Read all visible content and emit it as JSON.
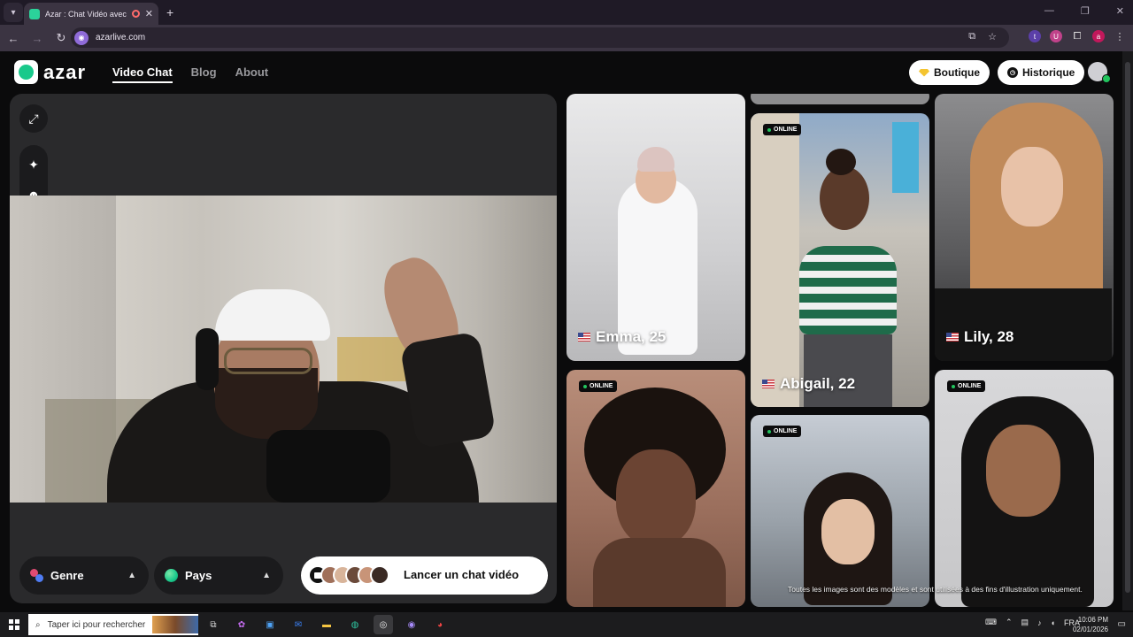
{
  "browser": {
    "tab_title": "Azar : Chat Vidéo avec de n",
    "url": "azarlive.com",
    "new_tab": "+",
    "tab_close": "✕",
    "nav_back": "←",
    "nav_forward": "→",
    "nav_reload": "↻",
    "window_controls": {
      "minimize": "—",
      "restore": "❐",
      "close": "✕"
    },
    "extensions": {
      "t": "t",
      "u": "U",
      "a": "a"
    }
  },
  "site": {
    "logo_text": "azar",
    "nav": {
      "video_chat": "Video Chat",
      "blog": "Blog",
      "about": "About"
    },
    "boutique_label": "Boutique",
    "historique_label": "Historique",
    "controls": {
      "genre_label": "Genre",
      "pays_label": "Pays",
      "launch_label": "Lancer un chat vidéo"
    },
    "gallery": {
      "online_label": "ONLINE",
      "emma": "Emma, 25",
      "abigail": "Abigail, 22",
      "lily": "Lily, 28",
      "disclaimer": "Toutes les images sont des modèles et sont utilisées à des fins d'illustration uniquement."
    }
  },
  "taskbar": {
    "search_placeholder": "Taper ici pour rechercher",
    "language": "FRA",
    "time": "10:06 PM",
    "date": "02/01/2026"
  },
  "colors": {
    "brand_green": "#19c98b",
    "online_green": "#22c55e",
    "panel_bg": "#2a2a2c"
  },
  "icons": [
    "search-icon",
    "expand-icon",
    "sparkle-icon",
    "face-filter-icon",
    "gem-icon",
    "clock-icon",
    "chevron-up-icon",
    "globe-icon",
    "camera-icon",
    "windows-icon"
  ]
}
